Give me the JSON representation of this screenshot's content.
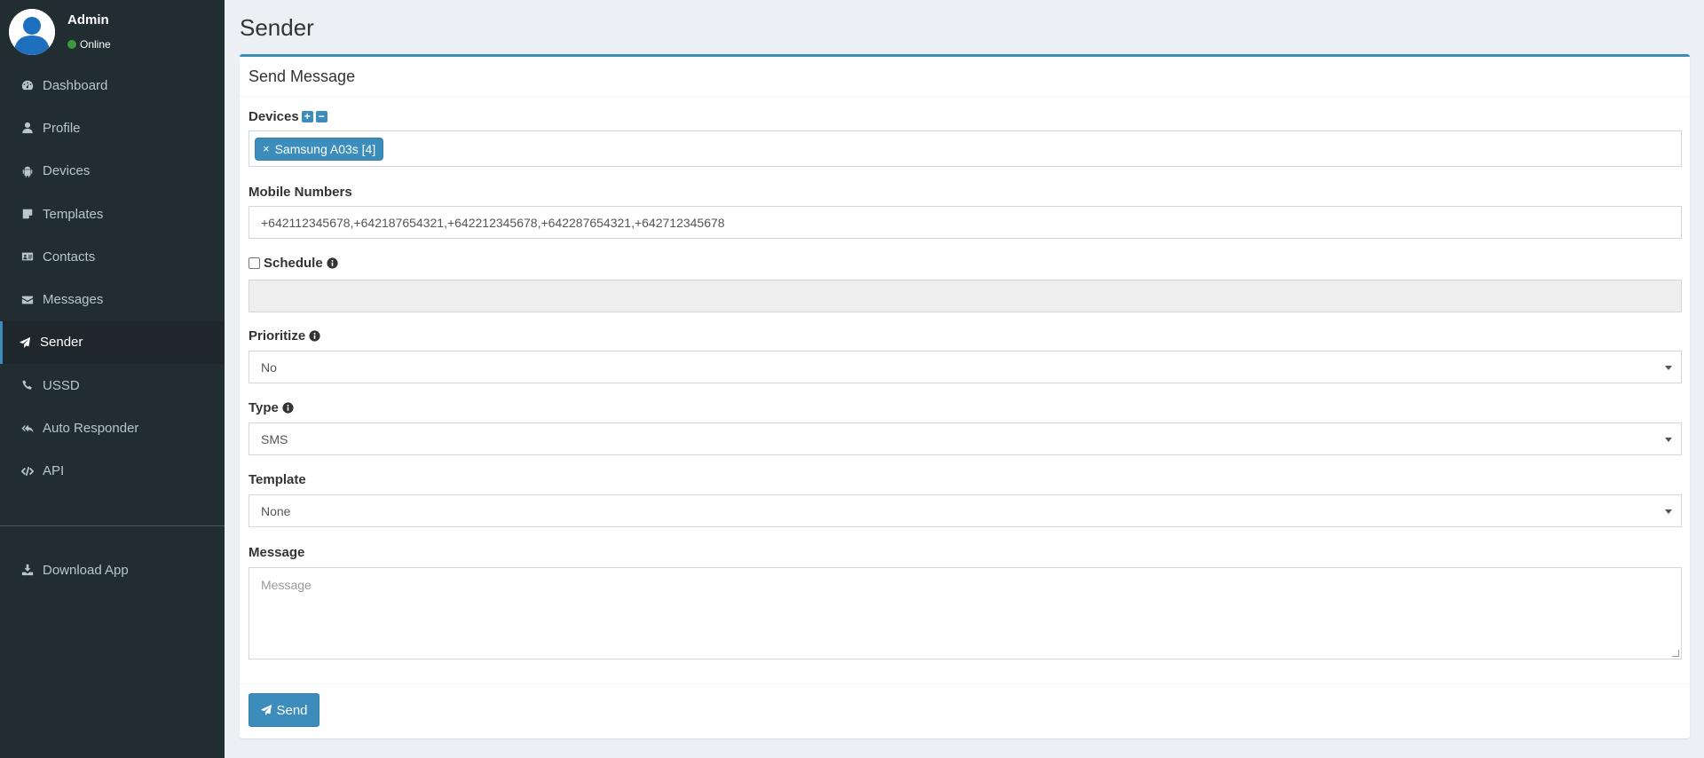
{
  "user": {
    "name": "Admin",
    "status": "Online"
  },
  "sidebar": {
    "items": [
      {
        "label": "Dashboard"
      },
      {
        "label": "Profile"
      },
      {
        "label": "Devices"
      },
      {
        "label": "Templates"
      },
      {
        "label": "Contacts"
      },
      {
        "label": "Messages"
      },
      {
        "label": "Sender"
      },
      {
        "label": "USSD"
      },
      {
        "label": "Auto Responder"
      },
      {
        "label": "API"
      }
    ],
    "download_label": "Download App",
    "active": "Sender"
  },
  "page": {
    "title": "Sender"
  },
  "form": {
    "title": "Send Message",
    "devices": {
      "label": "Devices",
      "add_icon": "+",
      "remove_icon": "−",
      "selected": [
        "Samsung A03s [4]"
      ],
      "tag_remove": "×"
    },
    "mobile_numbers": {
      "label": "Mobile Numbers",
      "value": "+642112345678,+642187654321,+642212345678,+642287654321,+642712345678"
    },
    "schedule": {
      "label": "Schedule",
      "value": ""
    },
    "prioritize": {
      "label": "Prioritize",
      "value": "No"
    },
    "type": {
      "label": "Type",
      "value": "SMS"
    },
    "template": {
      "label": "Template",
      "value": "None"
    },
    "message": {
      "label": "Message",
      "placeholder": "Message"
    },
    "send_label": "Send"
  },
  "colors": {
    "accent": "#3c8dbc",
    "sidebar_bg": "#222d32",
    "online": "#3c9a3c"
  }
}
